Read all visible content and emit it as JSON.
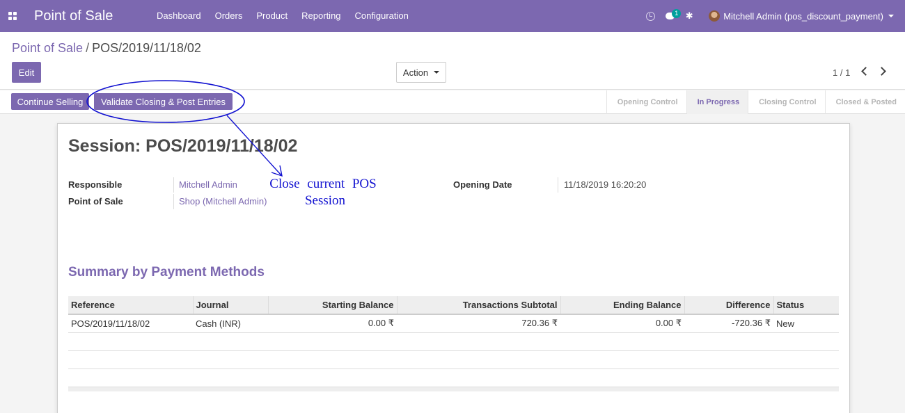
{
  "navbar": {
    "app_title": "Point of Sale",
    "menu": [
      "Dashboard",
      "Orders",
      "Product",
      "Reporting",
      "Configuration"
    ],
    "chat_badge": "1",
    "user": "Mitchell Admin (pos_discount_payment)",
    "accent_color": "#7c68b0"
  },
  "breadcrumb": {
    "parent": "Point of Sale",
    "separator": "/",
    "current": "POS/2019/11/18/02"
  },
  "controls": {
    "edit_label": "Edit",
    "action_label": "Action",
    "pager": "1 / 1"
  },
  "statusbar": {
    "continue_label": "Continue Selling",
    "validate_label": "Validate Closing & Post Entries",
    "stages": [
      "Opening Control",
      "In Progress",
      "Closing Control",
      "Closed & Posted"
    ],
    "active_stage": "In Progress"
  },
  "session": {
    "title": "Session: POS/2019/11/18/02",
    "responsible_label": "Responsible",
    "responsible_value": "Mitchell Admin",
    "pos_label": "Point of Sale",
    "pos_value": "Shop (Mitchell Admin)",
    "opening_label": "Opening Date",
    "opening_value": "11/18/2019 16:20:20"
  },
  "summary": {
    "title": "Summary by Payment Methods",
    "columns": [
      "Reference",
      "Journal",
      "Starting Balance",
      "Transactions Subtotal",
      "Ending Balance",
      "Difference",
      "Status"
    ],
    "rows": [
      {
        "reference": "POS/2019/11/18/02",
        "journal": "Cash (INR)",
        "starting": "0.00 ₹",
        "subtotal": "720.36 ₹",
        "ending": "0.00 ₹",
        "difference": "-720.36 ₹",
        "status": "New"
      }
    ]
  },
  "annotation": {
    "line1": "Close current POS",
    "line2": "Session",
    "color": "#1010d0"
  }
}
